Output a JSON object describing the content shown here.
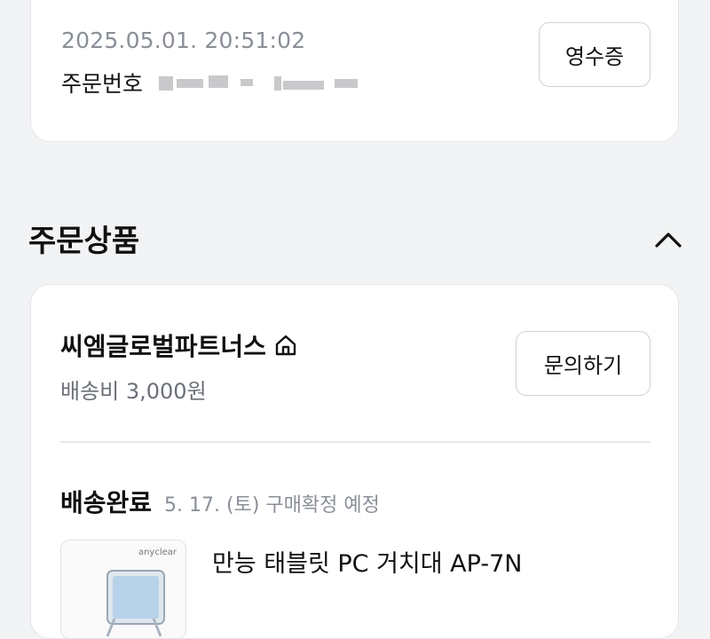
{
  "order": {
    "date": "2025.05.01. 20:51:02",
    "number_label": "주문번호",
    "receipt_button": "영수증"
  },
  "section": {
    "title": "주문상품"
  },
  "seller": {
    "name": "씨엠글로벌파트너스",
    "shipping_fee": "배송비 3,000원",
    "inquiry_button": "문의하기"
  },
  "delivery": {
    "status": "배송완료",
    "detail": "5. 17. (토) 구매확정 예정"
  },
  "product": {
    "thumb_brand": "anyclear",
    "name": "만능 태블릿 PC 거치대 AP-7N"
  }
}
